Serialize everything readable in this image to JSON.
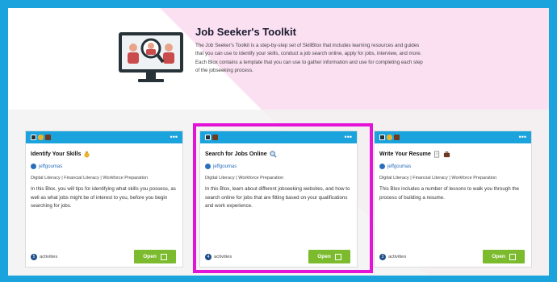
{
  "header": {
    "title": "Job Seeker's Toolkit",
    "description": "The Job Seeker's Toolkit is a step-by-step set of SkillBlox that includes learning resources and guides that you can use to identify your skills, conduct a job search online, apply for jobs, interview, and more. Each Blox contains a template that you can use to gather information and use for completing each step of the jobseeking process."
  },
  "colors": {
    "frame": "#1aa3dc",
    "card_bar": "#1aa3dc",
    "open_button": "#7cbb2e",
    "highlight": "#e413d8",
    "pink": "#fbe0f2"
  },
  "cards": [
    {
      "title": "Identify Your Skills",
      "title_icon": "money-bag-icon",
      "author": "jeffgoumas",
      "tags": "Digital Literacy | Financial Literacy | Workforce Preparation",
      "description": "In this Blox, you will tips for identifying what skills you possess, as well as what jobs might be of interest to you, before you begin searching for jobs.",
      "activities_count": "5",
      "activities_label": "activities",
      "open_label": "Open",
      "bar_icons": [
        "monitor-icon",
        "money-bag-icon",
        "briefcase-icon"
      ],
      "more": "•••"
    },
    {
      "title": "Search for Jobs Online",
      "title_icon": "magnifier-icon",
      "author": "jeffgoumas",
      "tags": "Digital Literacy | Workforce Preparation",
      "description": "In this Blox, learn about different jobseeking websites, and how to search online for jobs that are fitting based on your qualifications and work experience.",
      "activities_count": "4",
      "activities_label": "activities",
      "open_label": "Open",
      "bar_icons": [
        "monitor-icon",
        "briefcase-icon"
      ],
      "more": "•••"
    },
    {
      "title": "Write Your Resume",
      "title_icon": "document-icon",
      "author": "jeffgoumas",
      "tags": "Digital Literacy | Financial Literacy | Workforce Preparation",
      "description": "This Blox includes a number of lessons to walk you through the process of building a resume.",
      "activities_count": "3",
      "activities_label": "activities",
      "open_label": "Open",
      "bar_icons": [
        "monitor-icon",
        "money-bag-icon",
        "briefcase-icon"
      ],
      "more": "•••"
    }
  ]
}
